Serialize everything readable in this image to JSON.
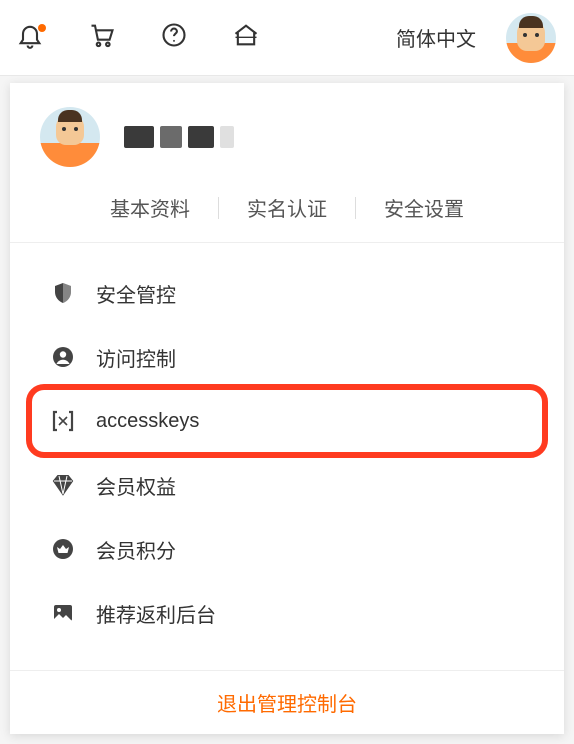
{
  "topbar": {
    "language": "简体中文"
  },
  "profile": {
    "tabs": {
      "basic_info": "基本资料",
      "real_name_auth": "实名认证",
      "security_settings": "安全设置"
    }
  },
  "menu": {
    "items": [
      {
        "label": "安全管控",
        "icon": "shield-icon"
      },
      {
        "label": "访问控制",
        "icon": "user-circle-icon"
      },
      {
        "label": "accesskeys",
        "icon": "key-brackets-icon"
      },
      {
        "label": "会员权益",
        "icon": "diamond-icon"
      },
      {
        "label": "会员积分",
        "icon": "crown-badge-icon"
      },
      {
        "label": "推荐返利后台",
        "icon": "image-icon"
      }
    ]
  },
  "logout": {
    "label": "退出管理控制台"
  },
  "highlight": {
    "target_index": 2
  }
}
